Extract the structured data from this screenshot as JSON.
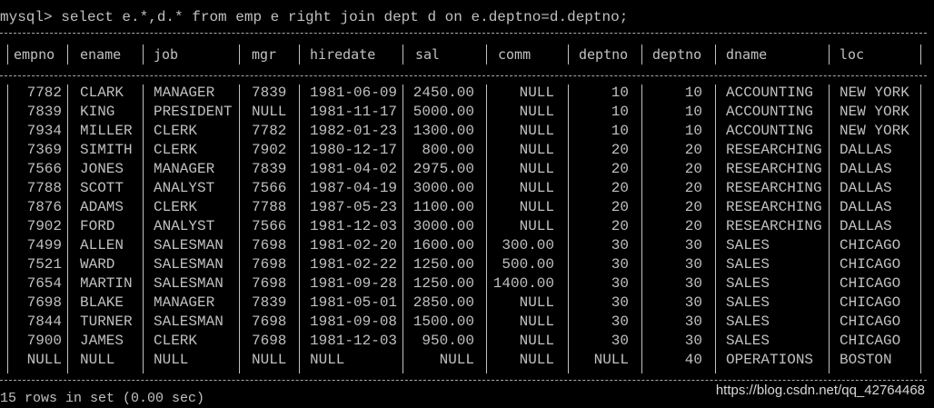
{
  "prompt": "mysql> select e.*,d.* from emp e right join dept d on e.deptno=d.deptno;",
  "columns": [
    "empno",
    "ename",
    "job",
    "mgr",
    "hiredate",
    "sal",
    "comm",
    "deptno",
    "deptno",
    "dname",
    "loc"
  ],
  "rows": [
    [
      "7782",
      "CLARK",
      "MANAGER",
      "7839",
      "1981-06-09",
      "2450.00",
      "NULL",
      "10",
      "10",
      "ACCOUNTING",
      "NEW YORK"
    ],
    [
      "7839",
      "KING",
      "PRESIDENT",
      "NULL",
      "1981-11-17",
      "5000.00",
      "NULL",
      "10",
      "10",
      "ACCOUNTING",
      "NEW YORK"
    ],
    [
      "7934",
      "MILLER",
      "CLERK",
      "7782",
      "1982-01-23",
      "1300.00",
      "NULL",
      "10",
      "10",
      "ACCOUNTING",
      "NEW YORK"
    ],
    [
      "7369",
      "SIMITH",
      "CLERK",
      "7902",
      "1980-12-17",
      "800.00",
      "NULL",
      "20",
      "20",
      "RESEARCHING",
      "DALLAS"
    ],
    [
      "7566",
      "JONES",
      "MANAGER",
      "7839",
      "1981-04-02",
      "2975.00",
      "NULL",
      "20",
      "20",
      "RESEARCHING",
      "DALLAS"
    ],
    [
      "7788",
      "SCOTT",
      "ANALYST",
      "7566",
      "1987-04-19",
      "3000.00",
      "NULL",
      "20",
      "20",
      "RESEARCHING",
      "DALLAS"
    ],
    [
      "7876",
      "ADAMS",
      "CLERK",
      "7788",
      "1987-05-23",
      "1100.00",
      "NULL",
      "20",
      "20",
      "RESEARCHING",
      "DALLAS"
    ],
    [
      "7902",
      "FORD",
      "ANALYST",
      "7566",
      "1981-12-03",
      "3000.00",
      "NULL",
      "20",
      "20",
      "RESEARCHING",
      "DALLAS"
    ],
    [
      "7499",
      "ALLEN",
      "SALESMAN",
      "7698",
      "1981-02-20",
      "1600.00",
      "300.00",
      "30",
      "30",
      "SALES",
      "CHICAGO"
    ],
    [
      "7521",
      "WARD",
      "SALESMAN",
      "7698",
      "1981-02-22",
      "1250.00",
      "500.00",
      "30",
      "30",
      "SALES",
      "CHICAGO"
    ],
    [
      "7654",
      "MARTIN",
      "SALESMAN",
      "7698",
      "1981-09-28",
      "1250.00",
      "1400.00",
      "30",
      "30",
      "SALES",
      "CHICAGO"
    ],
    [
      "7698",
      "BLAKE",
      "MANAGER",
      "7839",
      "1981-05-01",
      "2850.00",
      "NULL",
      "30",
      "30",
      "SALES",
      "CHICAGO"
    ],
    [
      "7844",
      "TURNER",
      "SALESMAN",
      "7698",
      "1981-09-08",
      "1500.00",
      "NULL",
      "30",
      "30",
      "SALES",
      "CHICAGO"
    ],
    [
      "7900",
      "JAMES",
      "CLERK",
      "7698",
      "1981-12-03",
      "950.00",
      "NULL",
      "30",
      "30",
      "SALES",
      "CHICAGO"
    ],
    [
      "NULL",
      "NULL",
      "NULL",
      "NULL",
      "NULL",
      "NULL",
      "NULL",
      "NULL",
      "40",
      "OPERATIONS",
      "BOSTON"
    ]
  ],
  "footer": "15 rows in set (0.00 sec)",
  "watermark": "https://blog.csdn.net/qq_42764468",
  "colors": {
    "background": "#000000",
    "text": "#c0c0c0"
  }
}
